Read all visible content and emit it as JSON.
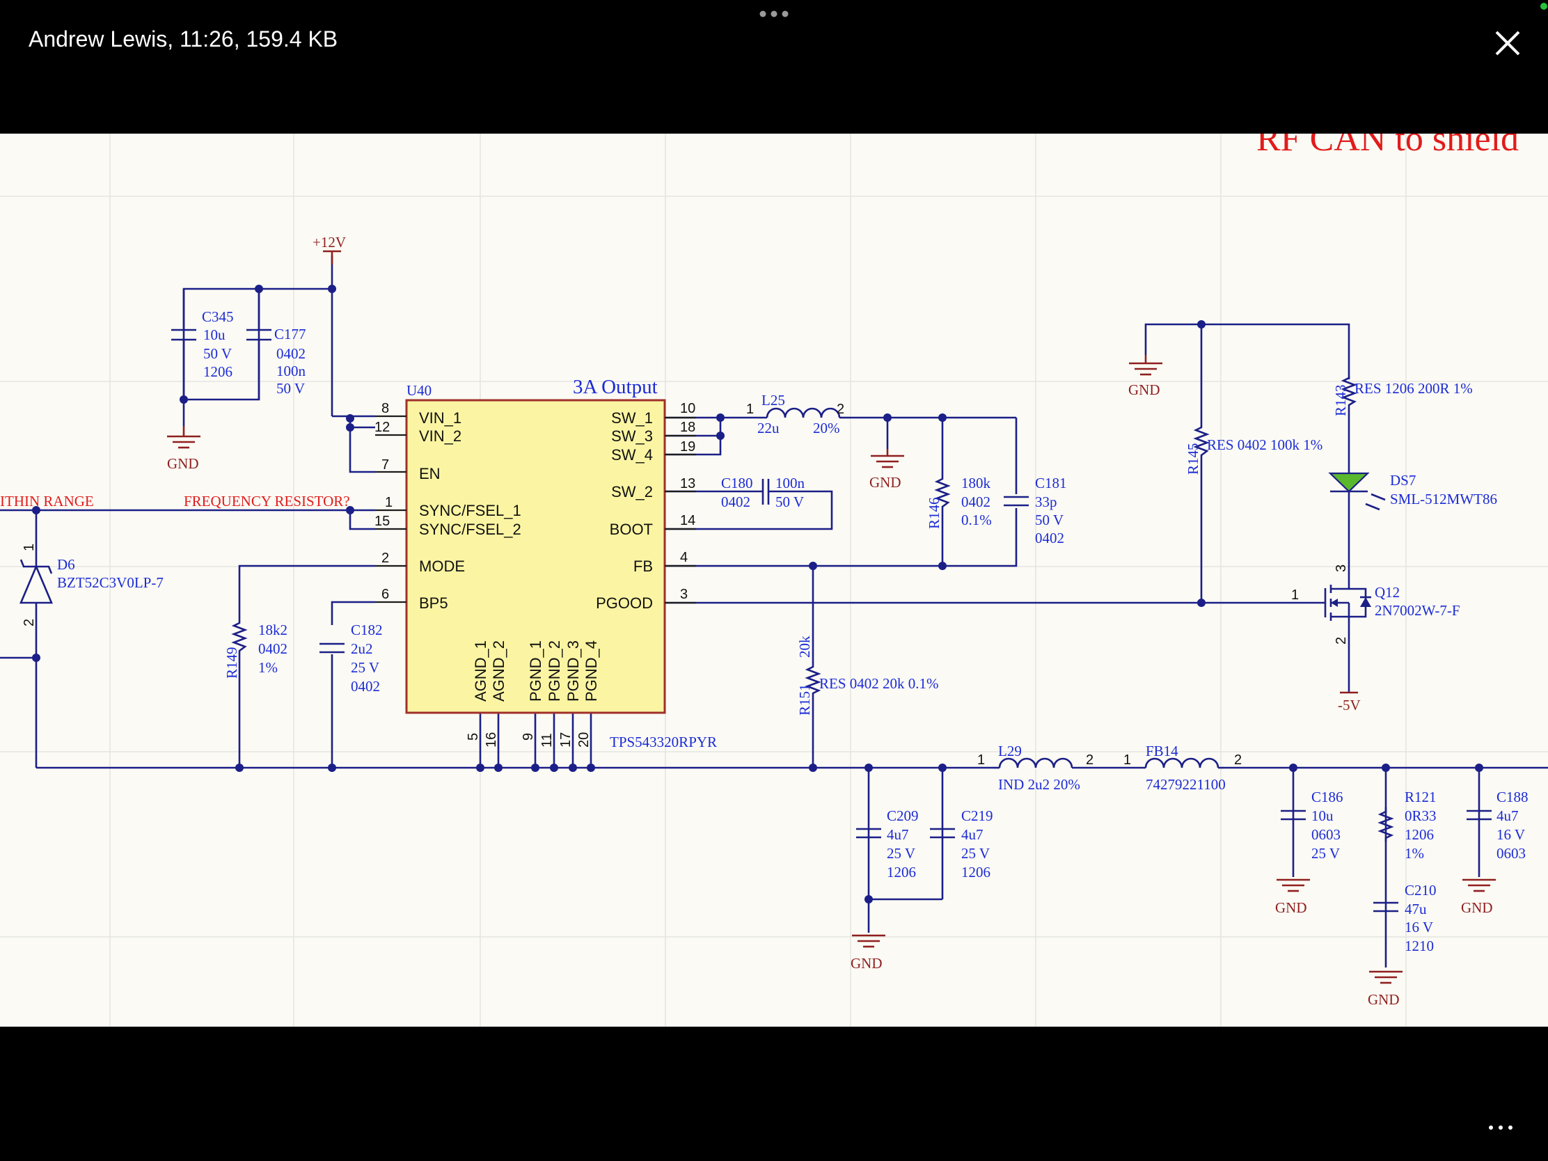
{
  "window": {
    "title": "Andrew Lewis, 11:26, 159.4 KB",
    "close_icon": "close-icon",
    "more_icon": "more-horizontal-icon"
  },
  "colors": {
    "wire": "#1b1f87",
    "label": "#1b2bd6",
    "power": "#8f1f1f",
    "note": "#e21b1b",
    "ic_fill": "#fbf5a3",
    "ic_border": "#a0302a",
    "led": "#5ab82c",
    "sheet": "#fbfaf4"
  },
  "schematic": {
    "header_note": "RF CAN to shield",
    "power": {
      "vin": "+12V",
      "gnd": "GND",
      "neg": "-5V"
    },
    "notes": {
      "within_range": "ITHIN RANGE",
      "freq_resistor": "FREQUENCY RESISTOR?"
    },
    "ic": {
      "ref": "U40",
      "title": "3A Output",
      "part": "TPS543320RPYR",
      "left_pins": [
        {
          "num": "8",
          "name": "VIN_1"
        },
        {
          "num": "12",
          "name": "VIN_2"
        },
        {
          "num": "7",
          "name": "EN"
        },
        {
          "num": "1",
          "name": "SYNC/FSEL_1"
        },
        {
          "num": "15",
          "name": "SYNC/FSEL_2"
        },
        {
          "num": "2",
          "name": "MODE"
        },
        {
          "num": "6",
          "name": "BP5"
        }
      ],
      "right_pins": [
        {
          "num": "10",
          "name": "SW_1"
        },
        {
          "num": "18",
          "name": "SW_3"
        },
        {
          "num": "19",
          "name": "SW_4"
        },
        {
          "num": "13",
          "name": "SW_2"
        },
        {
          "num": "14",
          "name": "BOOT"
        },
        {
          "num": "4",
          "name": "FB"
        },
        {
          "num": "3",
          "name": "PGOOD"
        }
      ],
      "bottom_pins": [
        {
          "num": "5",
          "name": "AGND_1"
        },
        {
          "num": "16",
          "name": "AGND_2"
        },
        {
          "num": "9",
          "name": "PGND_1"
        },
        {
          "num": "11",
          "name": "PGND_2"
        },
        {
          "num": "17",
          "name": "PGND_3"
        },
        {
          "num": "20",
          "name": "PGND_4"
        }
      ]
    },
    "parts": {
      "C345": [
        "C345",
        "10u",
        "50 V",
        "1206"
      ],
      "C177": [
        "C177",
        "0402",
        "100n",
        "50 V"
      ],
      "L25": [
        "L25",
        "22u",
        "20%"
      ],
      "C180": [
        "C180",
        "0402",
        "100n",
        "50 V"
      ],
      "R146": [
        "R146",
        "180k",
        "0402",
        "0.1%"
      ],
      "C181": [
        "C181",
        "33p",
        "50 V",
        "0402"
      ],
      "D6": [
        "D6",
        "BZT52C3V0LP-7"
      ],
      "R149": [
        "R149",
        "18k2",
        "0402",
        "1%"
      ],
      "C182": [
        "C182",
        "2u2",
        "25 V",
        "0402"
      ],
      "R151": [
        "R151",
        "20k",
        "RES 0402 20k 0.1%"
      ],
      "R143": [
        "R143",
        "RES 1206 200R 1%"
      ],
      "R145": [
        "R145",
        "RES 0402 100k 1%"
      ],
      "DS7": [
        "DS7",
        "SML-512MWT86"
      ],
      "Q12": [
        "Q12",
        "2N7002W-7-F"
      ],
      "L29": [
        "L29",
        "IND 2u2 20%"
      ],
      "FB14": [
        "FB14",
        "74279221100"
      ],
      "C209": [
        "C209",
        "4u7",
        "25 V",
        "1206"
      ],
      "C219": [
        "C219",
        "4u7",
        "25 V",
        "1206"
      ],
      "C186": [
        "C186",
        "10u",
        "0603",
        "25 V"
      ],
      "R121": [
        "R121",
        "0R33",
        "1206",
        "1%"
      ],
      "C210": [
        "C210",
        "47u",
        "16 V",
        "1210"
      ],
      "C188": [
        "C188",
        "4u7",
        "16 V",
        "0603"
      ]
    },
    "pin_labels": {
      "one": "1",
      "two": "2",
      "three": "3"
    }
  }
}
